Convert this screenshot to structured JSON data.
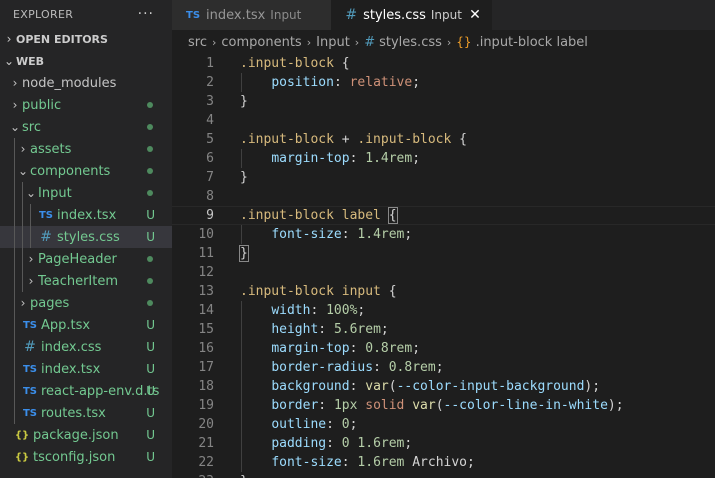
{
  "sidebar": {
    "title": "EXPLORER",
    "more_label": "···",
    "open_editors_label": "OPEN EDITORS",
    "workspace_label": "WEB",
    "items": [
      {
        "label": "node_modules",
        "depth": 0,
        "kind": "folder",
        "expanded": false,
        "color": "dim",
        "status": ""
      },
      {
        "label": "public",
        "depth": 0,
        "kind": "folder",
        "expanded": false,
        "color": "green",
        "status": "dot"
      },
      {
        "label": "src",
        "depth": 0,
        "kind": "folder",
        "expanded": true,
        "color": "green",
        "status": "dot"
      },
      {
        "label": "assets",
        "depth": 1,
        "kind": "folder",
        "expanded": false,
        "color": "green",
        "status": "dot"
      },
      {
        "label": "components",
        "depth": 1,
        "kind": "folder",
        "expanded": true,
        "color": "green",
        "status": "dot"
      },
      {
        "label": "Input",
        "depth": 2,
        "kind": "folder",
        "expanded": true,
        "color": "green",
        "status": "dot"
      },
      {
        "label": "index.tsx",
        "depth": 3,
        "kind": "ts",
        "color": "green",
        "status": "U"
      },
      {
        "label": "styles.css",
        "depth": 3,
        "kind": "css",
        "color": "green",
        "status": "U",
        "selected": true
      },
      {
        "label": "PageHeader",
        "depth": 2,
        "kind": "folder",
        "expanded": false,
        "color": "green",
        "status": "dot"
      },
      {
        "label": "TeacherItem",
        "depth": 2,
        "kind": "folder",
        "expanded": false,
        "color": "green",
        "status": "dot"
      },
      {
        "label": "pages",
        "depth": 1,
        "kind": "folder",
        "expanded": false,
        "color": "green",
        "status": "dot"
      },
      {
        "label": "App.tsx",
        "depth": 1,
        "kind": "ts",
        "color": "green",
        "status": "U"
      },
      {
        "label": "index.css",
        "depth": 1,
        "kind": "css",
        "color": "green",
        "status": "U"
      },
      {
        "label": "index.tsx",
        "depth": 1,
        "kind": "ts",
        "color": "green",
        "status": "U"
      },
      {
        "label": "react-app-env.d.ts",
        "depth": 1,
        "kind": "ts",
        "color": "green",
        "status": "U"
      },
      {
        "label": "routes.tsx",
        "depth": 1,
        "kind": "ts",
        "color": "green",
        "status": "U"
      },
      {
        "label": "package.json",
        "depth": 0,
        "kind": "json",
        "color": "green",
        "status": "U"
      },
      {
        "label": "tsconfig.json",
        "depth": 0,
        "kind": "json",
        "color": "green",
        "status": "U"
      }
    ]
  },
  "tabs": [
    {
      "icon": "TS",
      "label": "index.tsx",
      "desc": "Input",
      "active": false
    },
    {
      "icon": "#",
      "label": "styles.css",
      "desc": "Input",
      "active": true,
      "close": "✕"
    }
  ],
  "breadcrumb": [
    "src",
    "components",
    "Input",
    "styles.css",
    ".input-block label"
  ],
  "icons": {
    "ts": "TS",
    "css": "#",
    "json": "{}",
    "chevron_right": "›",
    "chevron_down": "⌄",
    "symbol": "{}"
  },
  "editor": {
    "current_line": 9,
    "lines": [
      [
        {
          "t": ".input-block",
          "c": "t-sel"
        },
        {
          "t": " {",
          "c": "t-pun"
        }
      ],
      [
        {
          "t": "    ",
          "c": ""
        },
        {
          "t": "position",
          "c": "t-prop"
        },
        {
          "t": ": ",
          "c": "t-pun"
        },
        {
          "t": "relative",
          "c": "t-val"
        },
        {
          "t": ";",
          "c": "t-pun"
        }
      ],
      [
        {
          "t": "}",
          "c": "t-pun"
        }
      ],
      [],
      [
        {
          "t": ".input-block",
          "c": "t-sel"
        },
        {
          "t": " + ",
          "c": "t-pun"
        },
        {
          "t": ".input-block",
          "c": "t-sel"
        },
        {
          "t": " {",
          "c": "t-pun"
        }
      ],
      [
        {
          "t": "    ",
          "c": ""
        },
        {
          "t": "margin-top",
          "c": "t-prop"
        },
        {
          "t": ": ",
          "c": "t-pun"
        },
        {
          "t": "1.4rem",
          "c": "t-num"
        },
        {
          "t": ";",
          "c": "t-pun"
        }
      ],
      [
        {
          "t": "}",
          "c": "t-pun"
        }
      ],
      [],
      [
        {
          "t": ".input-block label",
          "c": "t-sel"
        },
        {
          "t": " ",
          "c": ""
        },
        {
          "t": "{",
          "c": "t-pun bracket-hl"
        }
      ],
      [
        {
          "t": "    ",
          "c": ""
        },
        {
          "t": "font-size",
          "c": "t-prop"
        },
        {
          "t": ": ",
          "c": "t-pun"
        },
        {
          "t": "1.4rem",
          "c": "t-num"
        },
        {
          "t": ";",
          "c": "t-pun"
        }
      ],
      [
        {
          "t": "}",
          "c": "t-pun bracket-hl"
        }
      ],
      [],
      [
        {
          "t": ".input-block input",
          "c": "t-sel"
        },
        {
          "t": " {",
          "c": "t-pun"
        }
      ],
      [
        {
          "t": "    ",
          "c": ""
        },
        {
          "t": "width",
          "c": "t-prop"
        },
        {
          "t": ": ",
          "c": "t-pun"
        },
        {
          "t": "100%",
          "c": "t-num"
        },
        {
          "t": ";",
          "c": "t-pun"
        }
      ],
      [
        {
          "t": "    ",
          "c": ""
        },
        {
          "t": "height",
          "c": "t-prop"
        },
        {
          "t": ": ",
          "c": "t-pun"
        },
        {
          "t": "5.6rem",
          "c": "t-num"
        },
        {
          "t": ";",
          "c": "t-pun"
        }
      ],
      [
        {
          "t": "    ",
          "c": ""
        },
        {
          "t": "margin-top",
          "c": "t-prop"
        },
        {
          "t": ": ",
          "c": "t-pun"
        },
        {
          "t": "0.8rem",
          "c": "t-num"
        },
        {
          "t": ";",
          "c": "t-pun"
        }
      ],
      [
        {
          "t": "    ",
          "c": ""
        },
        {
          "t": "border-radius",
          "c": "t-prop"
        },
        {
          "t": ": ",
          "c": "t-pun"
        },
        {
          "t": "0.8rem",
          "c": "t-num"
        },
        {
          "t": ";",
          "c": "t-pun"
        }
      ],
      [
        {
          "t": "    ",
          "c": ""
        },
        {
          "t": "background",
          "c": "t-prop"
        },
        {
          "t": ": ",
          "c": "t-pun"
        },
        {
          "t": "var",
          "c": "t-fn"
        },
        {
          "t": "(",
          "c": "t-pun"
        },
        {
          "t": "--color-input-background",
          "c": "t-prop"
        },
        {
          "t": ");",
          "c": "t-pun"
        }
      ],
      [
        {
          "t": "    ",
          "c": ""
        },
        {
          "t": "border",
          "c": "t-prop"
        },
        {
          "t": ": ",
          "c": "t-pun"
        },
        {
          "t": "1px",
          "c": "t-num"
        },
        {
          "t": " ",
          "c": ""
        },
        {
          "t": "solid",
          "c": "t-val"
        },
        {
          "t": " ",
          "c": ""
        },
        {
          "t": "var",
          "c": "t-fn"
        },
        {
          "t": "(",
          "c": "t-pun"
        },
        {
          "t": "--color-line-in-white",
          "c": "t-prop"
        },
        {
          "t": ");",
          "c": "t-pun"
        }
      ],
      [
        {
          "t": "    ",
          "c": ""
        },
        {
          "t": "outline",
          "c": "t-prop"
        },
        {
          "t": ": ",
          "c": "t-pun"
        },
        {
          "t": "0",
          "c": "t-num"
        },
        {
          "t": ";",
          "c": "t-pun"
        }
      ],
      [
        {
          "t": "    ",
          "c": ""
        },
        {
          "t": "padding",
          "c": "t-prop"
        },
        {
          "t": ": ",
          "c": "t-pun"
        },
        {
          "t": "0",
          "c": "t-num"
        },
        {
          "t": " ",
          "c": ""
        },
        {
          "t": "1.6rem",
          "c": "t-num"
        },
        {
          "t": ";",
          "c": "t-pun"
        }
      ],
      [
        {
          "t": "    ",
          "c": ""
        },
        {
          "t": "font-size",
          "c": "t-prop"
        },
        {
          "t": ": ",
          "c": "t-pun"
        },
        {
          "t": "1.6rem",
          "c": "t-num"
        },
        {
          "t": " ",
          "c": ""
        },
        {
          "t": "Archivo",
          "c": "t-pun"
        },
        {
          "t": ";",
          "c": "t-pun"
        }
      ],
      [
        {
          "t": "}",
          "c": "t-pun"
        }
      ]
    ]
  }
}
